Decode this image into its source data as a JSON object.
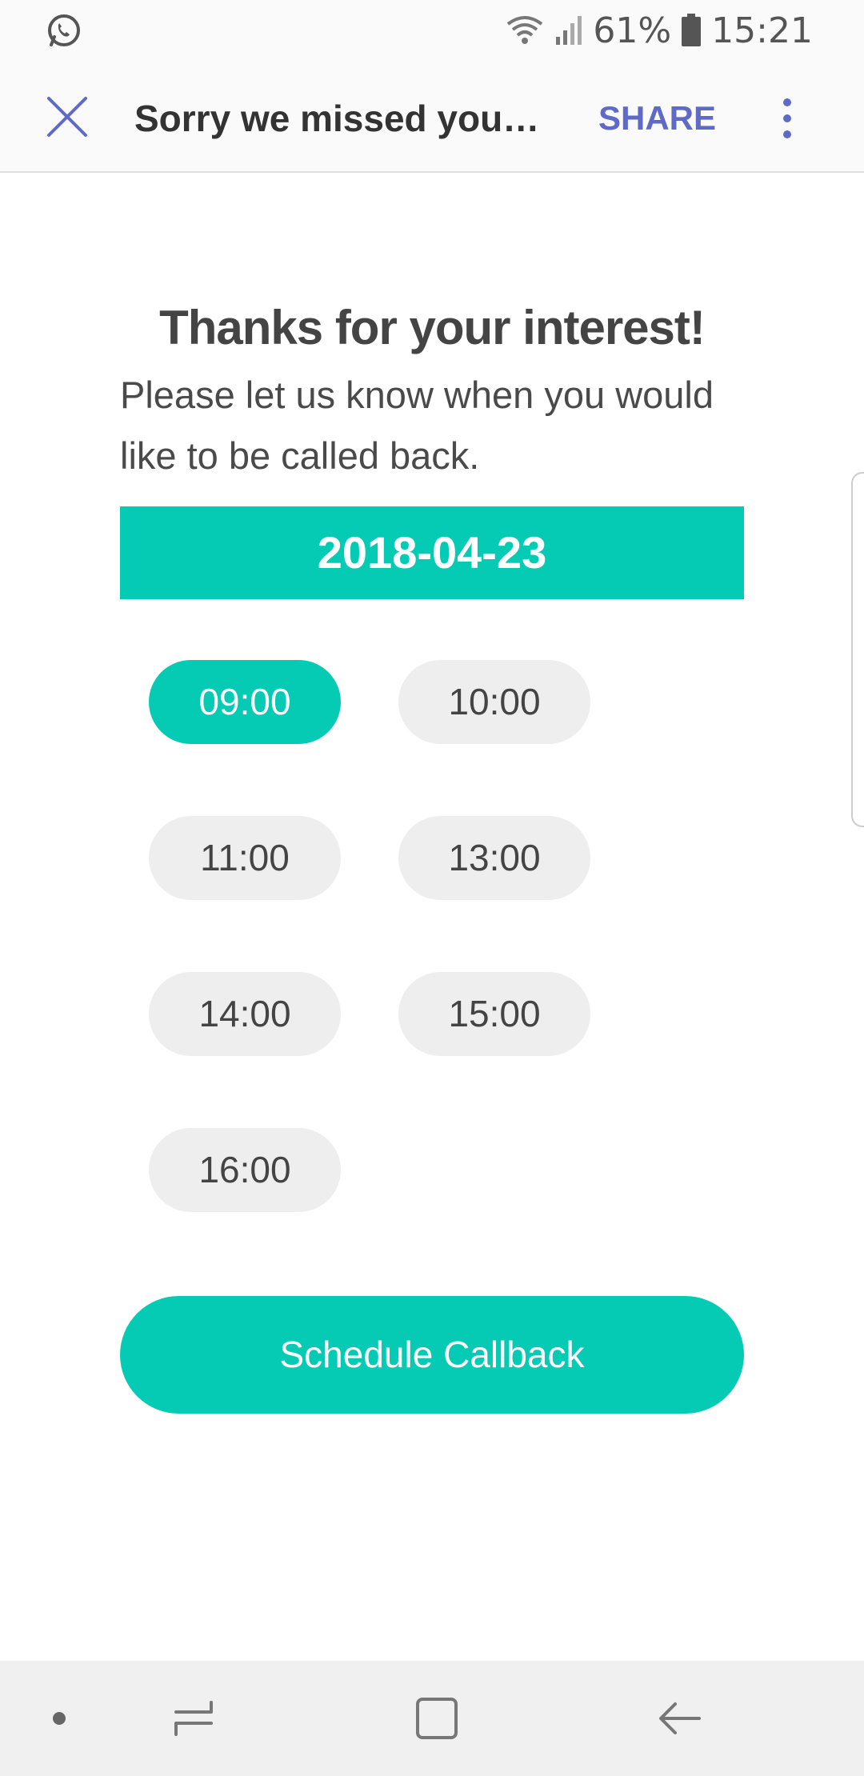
{
  "status_bar": {
    "battery": "61%",
    "time": "15:21"
  },
  "app_bar": {
    "title": "Sorry we missed your c…",
    "share_label": "SHARE",
    "accent_color": "#5e6ac6"
  },
  "content": {
    "heading": "Thanks for your interest!",
    "subtext": "Please let us know when you would like to be called back.",
    "date": "2018-04-23",
    "time_slots": [
      {
        "label": "09:00",
        "selected": true
      },
      {
        "label": "10:00",
        "selected": false
      },
      {
        "label": "11:00",
        "selected": false
      },
      {
        "label": "13:00",
        "selected": false
      },
      {
        "label": "14:00",
        "selected": false
      },
      {
        "label": "15:00",
        "selected": false
      },
      {
        "label": "16:00",
        "selected": false
      }
    ],
    "schedule_label": "Schedule Callback",
    "brand_color": "#05cbb5"
  }
}
